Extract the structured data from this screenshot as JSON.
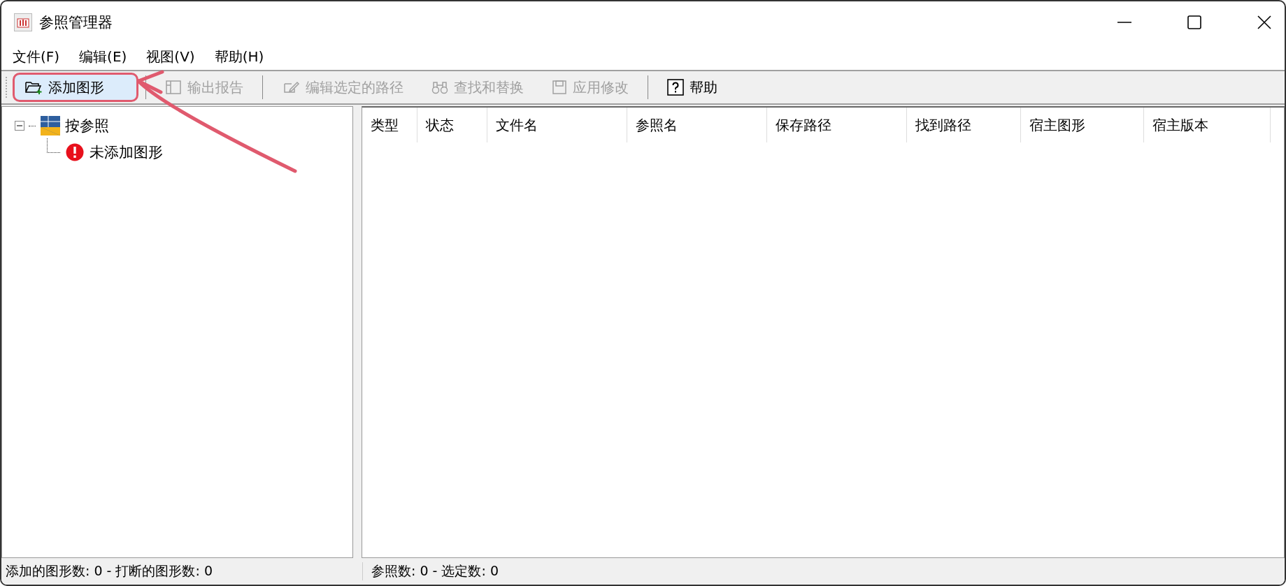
{
  "window": {
    "title": "参照管理器"
  },
  "menu": [
    "文件(F)",
    "编辑(E)",
    "视图(V)",
    "帮助(H)"
  ],
  "toolbar": [
    {
      "kind": "add",
      "label": "添加图形",
      "disabled": false,
      "highlighted": true,
      "separator_after": true
    },
    {
      "kind": "report",
      "label": "输出报告",
      "disabled": true,
      "highlighted": false,
      "separator_after": true
    },
    {
      "kind": "edit",
      "label": "编辑选定的路径",
      "disabled": true,
      "highlighted": false,
      "separator_after": false
    },
    {
      "kind": "find",
      "label": "查找和替换",
      "disabled": true,
      "highlighted": false,
      "separator_after": false
    },
    {
      "kind": "save",
      "label": "应用修改",
      "disabled": true,
      "highlighted": false,
      "separator_after": true
    },
    {
      "kind": "help",
      "label": "帮助",
      "disabled": false,
      "highlighted": false,
      "separator_after": false
    }
  ],
  "tree": [
    {
      "label": "按参照",
      "kind": "root",
      "expanded": true,
      "children": [
        {
          "label": "未添加图形",
          "kind": "error"
        }
      ]
    }
  ],
  "table": {
    "columns": [
      "类型",
      "状态",
      "文件名",
      "参照名",
      "保存路径",
      "找到路径",
      "宿主图形",
      "宿主版本"
    ]
  },
  "status_bar": {
    "left": "添加的图形数: 0  -  打断的图形数: 0",
    "right": "参照数: 0  -  选定数: 0"
  }
}
